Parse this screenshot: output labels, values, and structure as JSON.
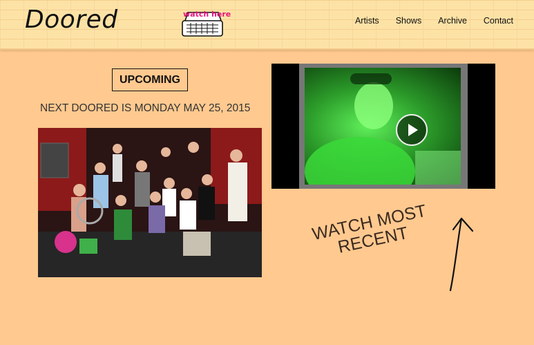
{
  "header": {
    "logo": "Doored",
    "watch_here": "watch here",
    "nav": [
      "Artists",
      "Shows",
      "Archive",
      "Contact"
    ]
  },
  "upcoming": {
    "label": "UPCOMING",
    "next_date": "NEXT DOORED IS MONDAY MAY 25, 2015"
  },
  "video": {
    "caption_line1": "WATCH MOST",
    "caption_line2": "RECENT"
  },
  "colors": {
    "background": "#ffc98f",
    "header": "#fde2a6",
    "accent_pink": "#e8157f"
  }
}
